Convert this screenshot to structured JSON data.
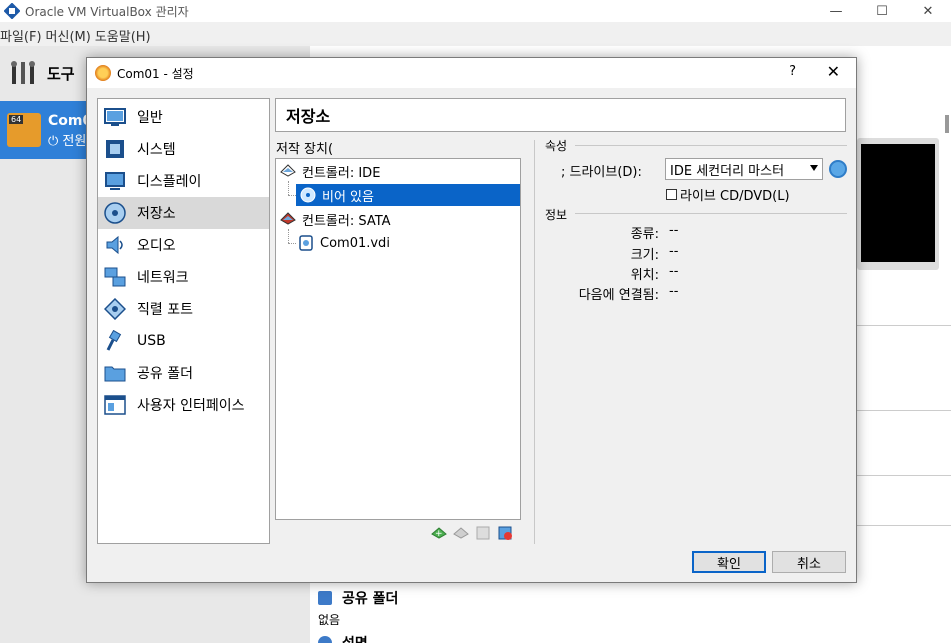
{
  "main_window": {
    "title": "Oracle VM VirtualBox 관리자",
    "menu": [
      "파일(F)",
      "머신(M)",
      "도움말(H)"
    ],
    "tools_label": "도구",
    "vm": {
      "name": "Com0",
      "state": "전원",
      "badge": "64"
    },
    "details": {
      "shared_folders_header": "공유 폴더",
      "shared_folders_value": "없음",
      "description_header": "설명"
    }
  },
  "dialog": {
    "title": "Com01 - 설정",
    "help": "?",
    "close": "✕",
    "categories": [
      {
        "label": "일반",
        "icon": "monitor-icon"
      },
      {
        "label": "시스템",
        "icon": "chip-icon"
      },
      {
        "label": "디스플레이",
        "icon": "display-icon"
      },
      {
        "label": "저장소",
        "icon": "storage-icon",
        "selected": true
      },
      {
        "label": "오디오",
        "icon": "speaker-icon"
      },
      {
        "label": "네트워크",
        "icon": "network-icon"
      },
      {
        "label": "직렬 포트",
        "icon": "serial-port-icon"
      },
      {
        "label": "USB",
        "icon": "usb-icon"
      },
      {
        "label": "공유 폴더",
        "icon": "folder-icon"
      },
      {
        "label": "사용자 인터페이스",
        "icon": "ui-icon"
      }
    ],
    "page_header": "저장소",
    "storage_devices_label": "저작 장치(",
    "tree": {
      "ide_controller": "컨트롤러: IDE",
      "ide_child": "비어 있음",
      "sata_controller": "컨트롤러: SATA",
      "sata_child": "Com01.vdi"
    },
    "attributes": {
      "title": "속성",
      "drive_label": "; 드라이브(D):",
      "drive_value": "IDE 세컨더리 마스터",
      "live_cd": "라이브 CD/DVD(L)"
    },
    "information": {
      "title": "정보",
      "rows": [
        {
          "key": "종류:",
          "value": "--"
        },
        {
          "key": "크기:",
          "value": "--"
        },
        {
          "key": "위치:",
          "value": "--"
        },
        {
          "key": "다음에 연결됨:",
          "value": "--"
        }
      ]
    },
    "ok_label": "확인",
    "cancel_label": "취소"
  }
}
